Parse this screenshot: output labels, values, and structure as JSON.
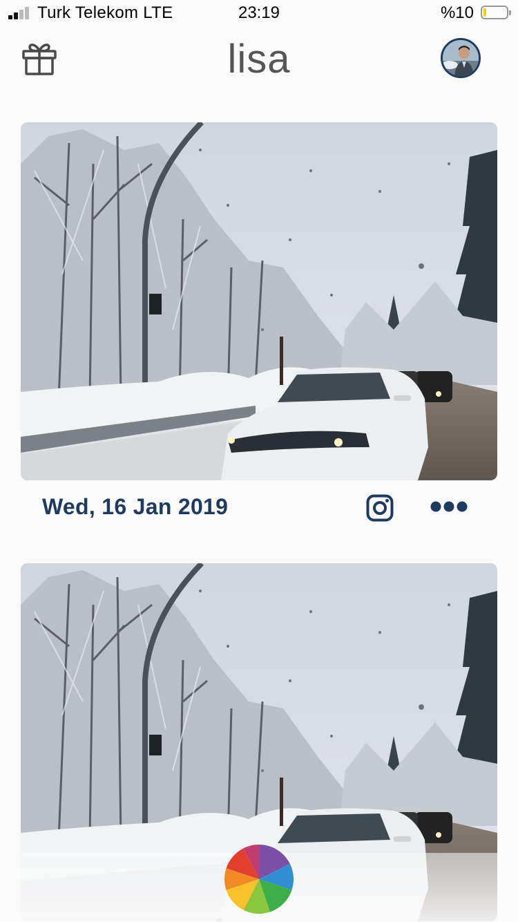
{
  "status_bar": {
    "carrier": "Turk Telekom  LTE",
    "time": "23:19",
    "battery": "%10"
  },
  "header": {
    "title": "lisa",
    "left_icon": "gift-icon",
    "right_icon": "profile-avatar"
  },
  "feed": [
    {
      "date": "Wed, 16 Jan 2019",
      "share_icon": "instagram-icon",
      "menu_icon": "more-dots-icon"
    }
  ],
  "colors": {
    "accent": "#1e3a5f",
    "background": "#fafafa",
    "battery_low": "#ffcc00"
  },
  "bottom_bar": {
    "icon": "capture-ring-icon"
  }
}
